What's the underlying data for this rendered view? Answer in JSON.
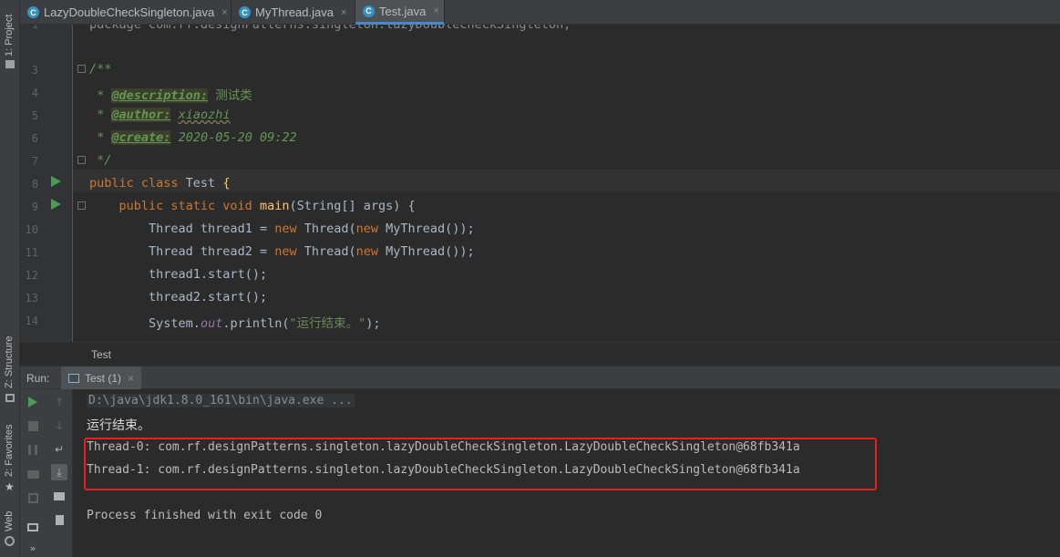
{
  "left_strip": {
    "project_label": "1: Project",
    "structure_label": "Z: Structure",
    "favorites_label": "2: Favorites",
    "web_label": "Web"
  },
  "tabs": [
    {
      "label": "LazyDoubleCheckSingleton.java",
      "icon": "class-icon",
      "active": false,
      "close": "×"
    },
    {
      "label": "MyThread.java",
      "icon": "class-icon",
      "active": false,
      "close": "×"
    },
    {
      "label": "Test.java",
      "icon": "class-icon",
      "active": true,
      "close": "×"
    }
  ],
  "editor": {
    "line_numbers": [
      "1",
      "3",
      "4",
      "5",
      "6",
      "7",
      "8",
      "9",
      "10",
      "11",
      "12",
      "13",
      "14"
    ],
    "line1": "package com.rf.designPatterns.singleton.lazyDoubleCheckSingleton;",
    "doc_open": "/**",
    "doc_star": "* ",
    "desc_tag": "@description:",
    "desc_value": " 测试类",
    "author_tag": "@author:",
    "author_value": "xiaozhi",
    "create_tag": "@create:",
    "create_value": " 2020-05-20 09:22",
    "doc_close": "*/",
    "class_kw": "public class ",
    "class_name": "Test ",
    "class_brace": "{",
    "main_kw": "public static void ",
    "main_name": "main",
    "main_args": "(String[] args) {",
    "t1_decl": "Thread thread1 = ",
    "t2_decl": "Thread thread2 = ",
    "new_kw": "new",
    "thread_ctor_open": " Thread(",
    "mythread_ctor": " MyThread());",
    "start1": "thread1.start();",
    "start2": "thread2.start();",
    "sysout_prefix": "System.",
    "sysout_out": "out",
    "sysout_println": ".println(",
    "sysout_str": "\"运行结束。\"",
    "sysout_end": ");"
  },
  "breadcrumb": "Test",
  "run": {
    "label": "Run:",
    "tab": "Test (1)",
    "close": "×"
  },
  "console": {
    "command": "D:\\java\\jdk1.8.0_161\\bin\\java.exe ...",
    "line_cn": "运行结束。",
    "thread0": "Thread-0: com.rf.designPatterns.singleton.lazyDoubleCheckSingleton.LazyDoubleCheckSingleton@68fb341a",
    "thread1": "Thread-1: com.rf.designPatterns.singleton.lazyDoubleCheckSingleton.LazyDoubleCheckSingleton@68fb341a",
    "exit": "Process finished with exit code 0"
  },
  "colors": {
    "keyword": "#cc7832",
    "comment": "#629755",
    "string": "#6a8759",
    "highlight_box": "#e8201f",
    "run_green": "#499c54"
  }
}
